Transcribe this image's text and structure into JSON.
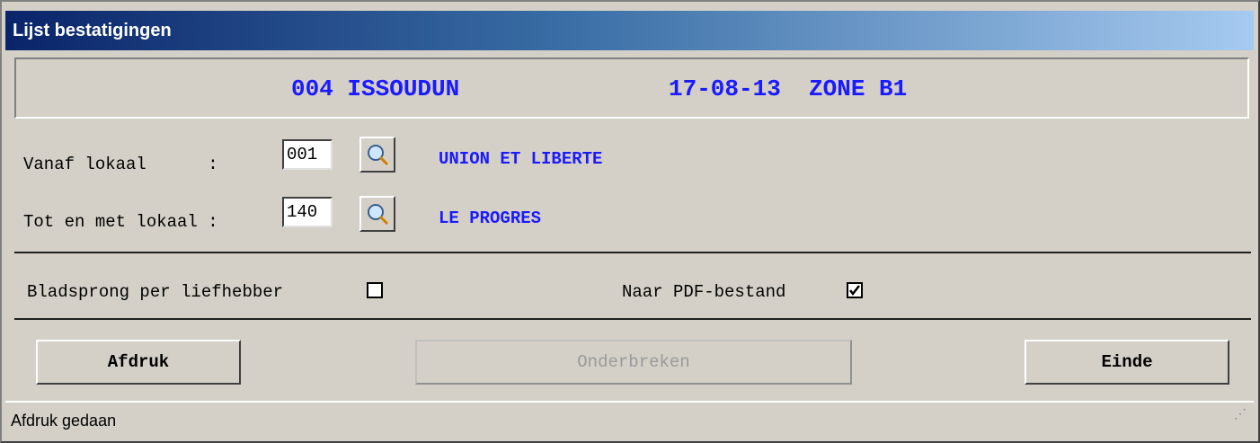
{
  "window": {
    "title": "Lijst bestatigingen"
  },
  "header": {
    "code_name": "004 ISSOUDUN",
    "date_zone": "17-08-13  ZONE B1"
  },
  "range": {
    "from": {
      "label": "Vanaf lokaal      :",
      "value": "001",
      "name": "UNION ET LIBERTE"
    },
    "to": {
      "label": "Tot en met lokaal :",
      "value": "140",
      "name": "LE PROGRES"
    }
  },
  "options": {
    "page_break": {
      "label": "Bladsprong per liefhebber",
      "checked": false
    },
    "to_pdf": {
      "label": "Naar PDF-bestand",
      "checked": true
    }
  },
  "buttons": {
    "print": "Afdruk",
    "cancel": "Onderbreken",
    "end": "Einde"
  },
  "status": {
    "text": "Afdruk gedaan"
  },
  "colors": {
    "accent_text": "#1a1aff",
    "title_start": "#0a246a",
    "title_end": "#a6caf0"
  }
}
